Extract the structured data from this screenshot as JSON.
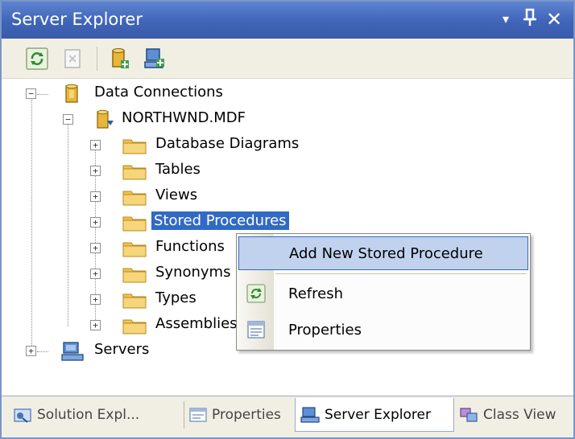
{
  "window": {
    "title": "Server Explorer",
    "dropdown_glyph": "▾",
    "pin_glyph": "ᛝ",
    "close_glyph": "✕"
  },
  "toolbar": {
    "tools": [
      {
        "name": "refresh",
        "icon": "refresh-icon"
      },
      {
        "name": "stop-refresh",
        "icon": "stop-icon"
      },
      {
        "name": "connect-to-database",
        "icon": "connect-database-icon"
      },
      {
        "name": "connect-to-server",
        "icon": "connect-server-icon"
      }
    ]
  },
  "tree": {
    "data_connections": "Data Connections",
    "database": "NORTHWND.MDF",
    "folders": [
      "Database Diagrams",
      "Tables",
      "Views",
      "Stored Procedures",
      "Functions",
      "Synonyms",
      "Types",
      "Assemblies"
    ],
    "selected_folder": "Stored Procedures",
    "servers": "Servers",
    "expanded_glyph": "−",
    "collapsed_glyph": "+"
  },
  "context_menu": {
    "items": [
      {
        "label": "Add New Stored Procedure",
        "icon": null,
        "highlighted": true
      },
      {
        "label": "Refresh",
        "icon": "refresh-icon",
        "highlighted": false
      },
      {
        "label": "Properties",
        "icon": "properties-icon",
        "highlighted": false
      }
    ]
  },
  "tabs": [
    {
      "label": "Solution Expl...",
      "icon": "solution-explorer-icon",
      "active": false
    },
    {
      "label": "Properties",
      "icon": "properties-icon",
      "active": false
    },
    {
      "label": "Server Explorer",
      "icon": "server-explorer-icon",
      "active": true
    },
    {
      "label": "Class View",
      "icon": "class-view-icon",
      "active": false
    }
  ],
  "colors": {
    "title_bar": "#3f64b8",
    "selection": "#316ac5",
    "menu_highlight": "#c1d2ee",
    "folder": "#f2c14e"
  }
}
